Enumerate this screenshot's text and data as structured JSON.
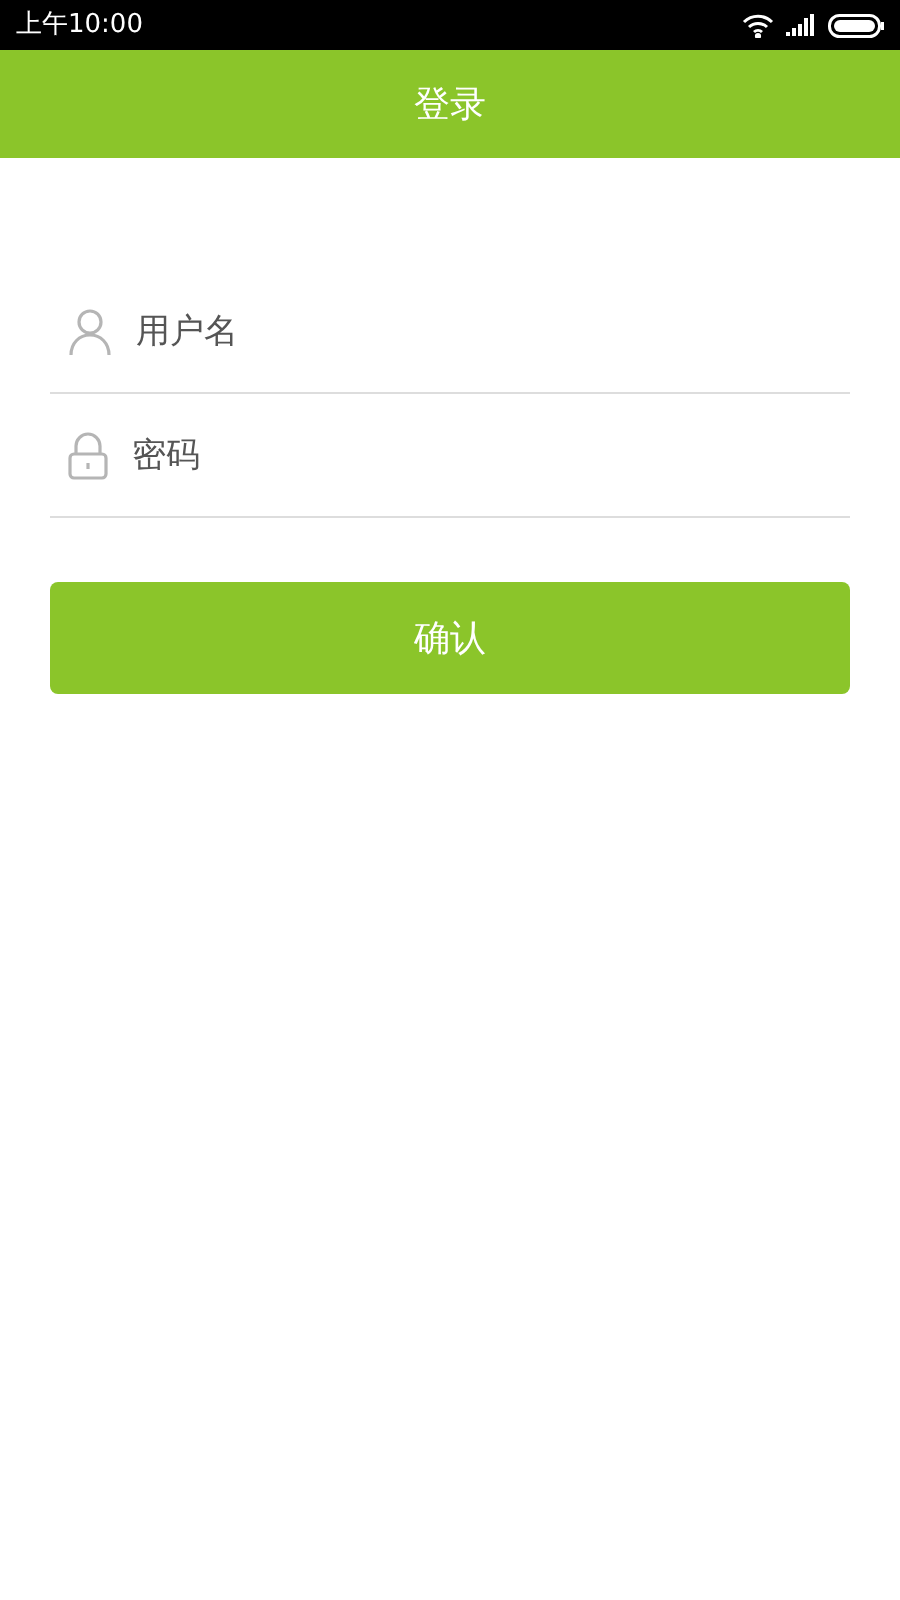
{
  "status_bar": {
    "time": "上午10:00"
  },
  "header": {
    "title": "登录"
  },
  "fields": [
    {
      "kind": "user",
      "placeholder": "用户名"
    },
    {
      "kind": "lock",
      "placeholder": "密码"
    }
  ],
  "submit_button": {
    "label": "确认"
  }
}
